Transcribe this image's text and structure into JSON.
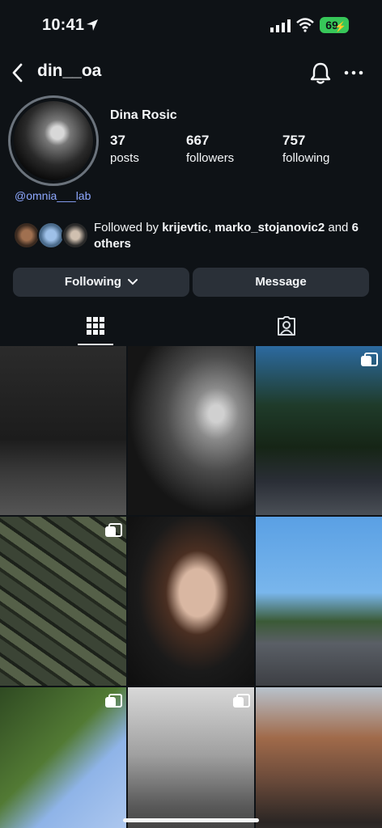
{
  "status_bar": {
    "time": "10:41",
    "battery": "69",
    "icons": [
      "location-arrow-icon",
      "cellular-signal-icon",
      "wifi-icon",
      "battery-charging-icon"
    ]
  },
  "header": {
    "username": "din__oa",
    "icons": [
      "back-chevron-icon",
      "bell-icon",
      "more-dots-icon"
    ]
  },
  "profile": {
    "display_name": "Dina Rosic",
    "stats": [
      {
        "value": "37",
        "label": "posts"
      },
      {
        "value": "667",
        "label": "followers"
      },
      {
        "value": "757",
        "label": "following"
      }
    ],
    "threads_handle": "@omnia___lab",
    "followed_by": {
      "prefix": "Followed by ",
      "user1": "krijevtic",
      "separator": ", ",
      "user2": "marko_stojanovic2",
      "middle": " and ",
      "others": "6 others"
    }
  },
  "actions": {
    "following_label": "Following",
    "message_label": "Message"
  },
  "tabs": [
    {
      "name": "posts-grid",
      "icon": "grid-icon",
      "active": true
    },
    {
      "name": "tagged",
      "icon": "tagged-person-icon",
      "active": false
    }
  ],
  "colors": {
    "background": "#0e1216",
    "button": "#2a3038",
    "link": "#8ea8ff",
    "battery": "#37c759"
  }
}
